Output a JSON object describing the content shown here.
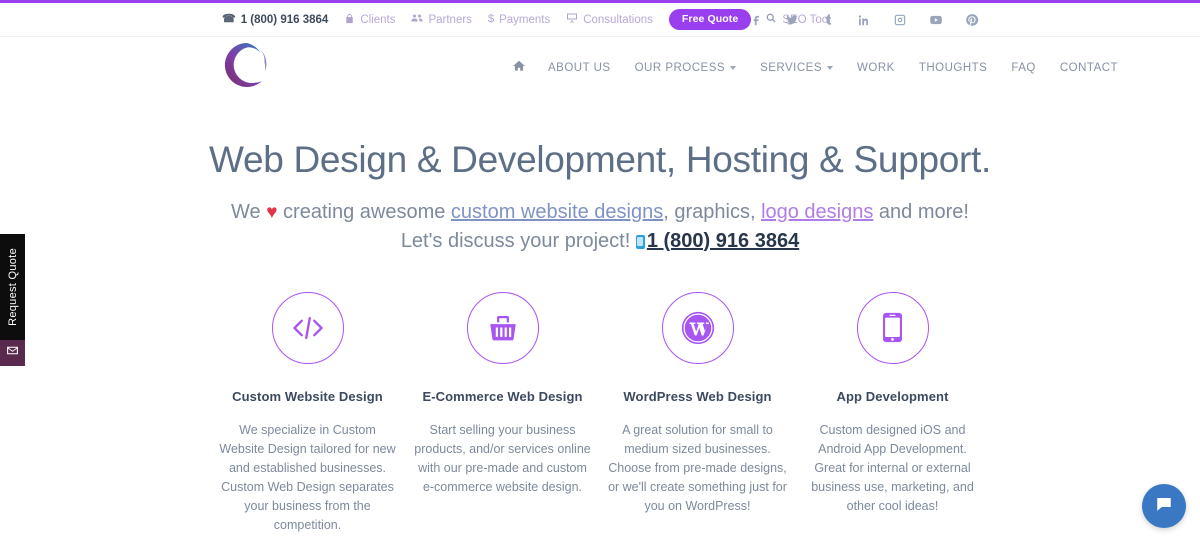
{
  "theme": {
    "purple": "#9a3ff0",
    "icon_purple": "#a855f2",
    "heading_color": "#5c6f86",
    "body_color": "#7d8a9c",
    "link_blue": "#7f93c4",
    "link_purple": "#b07de8",
    "chat_blue": "#3b78c4"
  },
  "utility_bar": {
    "phone": "1 (800) 916 3864",
    "phone_icon": "phone-icon",
    "links": [
      {
        "label": "Clients",
        "icon": "lock-icon"
      },
      {
        "label": "Partners",
        "icon": "users-icon"
      },
      {
        "label": "Payments",
        "icon": "dollar-icon"
      },
      {
        "label": "Consultations",
        "icon": "presentation-screen-icon"
      }
    ],
    "free_quote_label": "Free Quote",
    "seo_tool_label": "SEO Tool",
    "seo_tool_icon": "search-icon",
    "social": [
      {
        "name": "facebook-icon"
      },
      {
        "name": "twitter-icon"
      },
      {
        "name": "tumblr-icon"
      },
      {
        "name": "linkedin-icon"
      },
      {
        "name": "instagram-icon"
      },
      {
        "name": "youtube-icon"
      },
      {
        "name": "pinterest-icon"
      }
    ]
  },
  "header": {
    "logo_alt": "circular brush stroke logo",
    "nav": [
      {
        "label": "",
        "icon": "home-icon",
        "caret": false
      },
      {
        "label": "ABOUT US",
        "caret": false
      },
      {
        "label": "OUR PROCESS",
        "caret": true
      },
      {
        "label": "SERVICES",
        "caret": true
      },
      {
        "label": "WORK",
        "caret": false
      },
      {
        "label": "THOUGHTS",
        "caret": false
      },
      {
        "label": "FAQ",
        "caret": false
      },
      {
        "label": "CONTACT",
        "caret": false
      }
    ]
  },
  "hero": {
    "title": "Web Design & Development, Hosting & Support.",
    "sub_line1_a": "We ",
    "sub_heart": "♥",
    "sub_line1_b": " creating awesome ",
    "sub_link_blue": "custom website designs",
    "sub_line1_c": ", graphics, ",
    "sub_link_purple": "logo designs",
    "sub_line1_d": " and more!",
    "sub_line2": "Let's discuss your project! ",
    "sub_phone": "1 (800) 916 3864"
  },
  "services": [
    {
      "icon": "code-brackets-icon",
      "title": "Custom Website Design",
      "desc": "We specialize in Custom Website Design tailored for new and established businesses. Custom Web Design separates your business from the competition."
    },
    {
      "icon": "shopping-basket-icon",
      "title": "E-Commerce Web Design",
      "desc": "Start selling your business products, and/or services online with our pre-made and custom e-commerce website design."
    },
    {
      "icon": "wordpress-icon",
      "title": "WordPress Web Design",
      "desc": "A great solution for small to medium sized businesses. Choose from pre-made designs, or we'll create something just for you on WordPress!"
    },
    {
      "icon": "mobile-phone-icon",
      "title": "App Development",
      "desc": "Custom designed iOS and Android App Development. Great for internal or external business use, marketing, and other cool ideas!"
    }
  ],
  "side_tab": {
    "label": "Request Quote",
    "mail_icon": "envelope-icon"
  },
  "chat_widget": {
    "icon": "chat-bubble-icon"
  }
}
